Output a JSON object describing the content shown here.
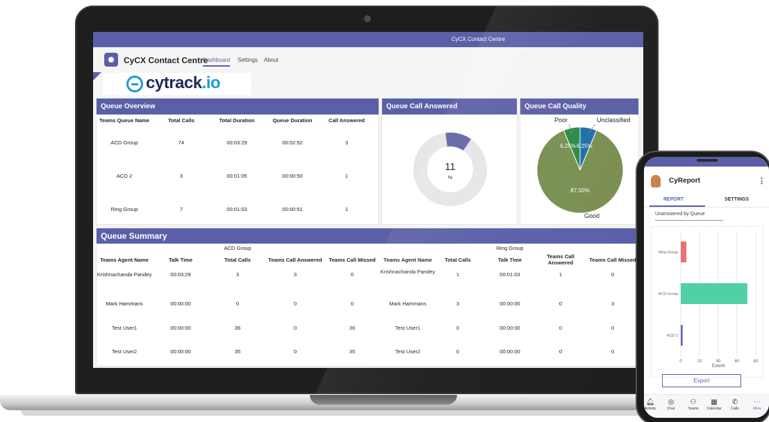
{
  "window": {
    "title": "CyCX Contact Centre"
  },
  "app": {
    "name": "CyCX Contact Centre",
    "tabs": [
      {
        "label": "Dashboard"
      },
      {
        "label": "Settings"
      },
      {
        "label": "About"
      }
    ],
    "brand": {
      "prefix": "cytrack",
      "suffix": ".io"
    }
  },
  "queue_overview": {
    "title": "Queue Overview",
    "headers": [
      "Teams Queue Name",
      "Total Calls",
      "Total Duration",
      "Queue Duration",
      "Call Answered"
    ],
    "rows": [
      [
        "ACD Group",
        "74",
        "00:03:29",
        "00:02:52",
        "3"
      ],
      [
        "ACD 2",
        "3",
        "00:01:05",
        "00:00:50",
        "1"
      ],
      [
        "Ring Group",
        "7",
        "00:01:03",
        "00:00:51",
        "1"
      ]
    ]
  },
  "queue_call_answered": {
    "title": "Queue Call Answered",
    "value": "11",
    "unit": "%",
    "fraction": 0.11,
    "colors": {
      "fill": "#6264a7",
      "track": "#e6e6e6"
    }
  },
  "queue_call_quality": {
    "title": "Queue Call Quality",
    "slices": [
      {
        "label": "Poor",
        "pct": 6.25,
        "pct_label": "6.25%",
        "color": "#2e8b4a"
      },
      {
        "label": "Unclassified",
        "pct": 6.25,
        "pct_label": "6.25%",
        "color": "#1f6fa8"
      },
      {
        "label": "Good",
        "pct": 87.5,
        "pct_label": "87.50%",
        "color": "#7a8f52"
      }
    ]
  },
  "queue_summary": {
    "title": "Queue Summary",
    "groups": [
      "ACD Group",
      "Ring Group"
    ],
    "headers_left": [
      "Teams Agent Name",
      "Talk Time",
      "Total Calls",
      "Teams Call Answered",
      "Teams Call Missed"
    ],
    "headers_right": [
      "Teams Agent Name",
      "Total Calls",
      "Talk Time",
      "Teams Call Answered",
      "Teams Call Missed"
    ],
    "rows": [
      [
        "Krishnachanda Pandey",
        "00:03:29",
        "3",
        "3",
        "0",
        "Krishnachanda Pandey",
        "1",
        "00:01:03",
        "1",
        "0"
      ],
      [
        "Mark Hammans",
        "00:00:00",
        "0",
        "0",
        "0",
        "Mark Hammans",
        "3",
        "00:00:00",
        "0",
        "3"
      ],
      [
        "Test User1",
        "00:00:00",
        "36",
        "0",
        "36",
        "Test User1",
        "0",
        "00:00:00",
        "0",
        "0"
      ],
      [
        "Test User2",
        "00:00:00",
        "35",
        "0",
        "35",
        "Test User2",
        "0",
        "00:00:00",
        "0",
        "0"
      ]
    ]
  },
  "phone": {
    "app_title": "CyReport",
    "tabs": [
      "REPORT",
      "SETTINGS"
    ],
    "dropdown": "Unanswered by Queue",
    "export_label": "Export",
    "nav": [
      {
        "label": "Activity",
        "icon": "bell-icon"
      },
      {
        "label": "Chat",
        "icon": "chat-icon"
      },
      {
        "label": "Teams",
        "icon": "teams-icon"
      },
      {
        "label": "Calendar",
        "icon": "calendar-icon"
      },
      {
        "label": "Calls",
        "icon": "calls-icon"
      },
      {
        "label": "More",
        "icon": "more-icon"
      }
    ]
  },
  "chart_data": {
    "type": "bar",
    "orientation": "horizontal",
    "title": "Unanswered by Queue",
    "xlabel": "Count",
    "ylabel": "",
    "categories": [
      "Ring Group",
      "ACD Group",
      "ACD 2"
    ],
    "values": [
      6,
      71,
      2
    ],
    "colors": [
      "#e57373",
      "#4fd1a5",
      "#5c6bc0"
    ],
    "xlim": [
      0,
      80
    ],
    "xticks": [
      0,
      20,
      40,
      60,
      80
    ],
    "grid": true
  }
}
